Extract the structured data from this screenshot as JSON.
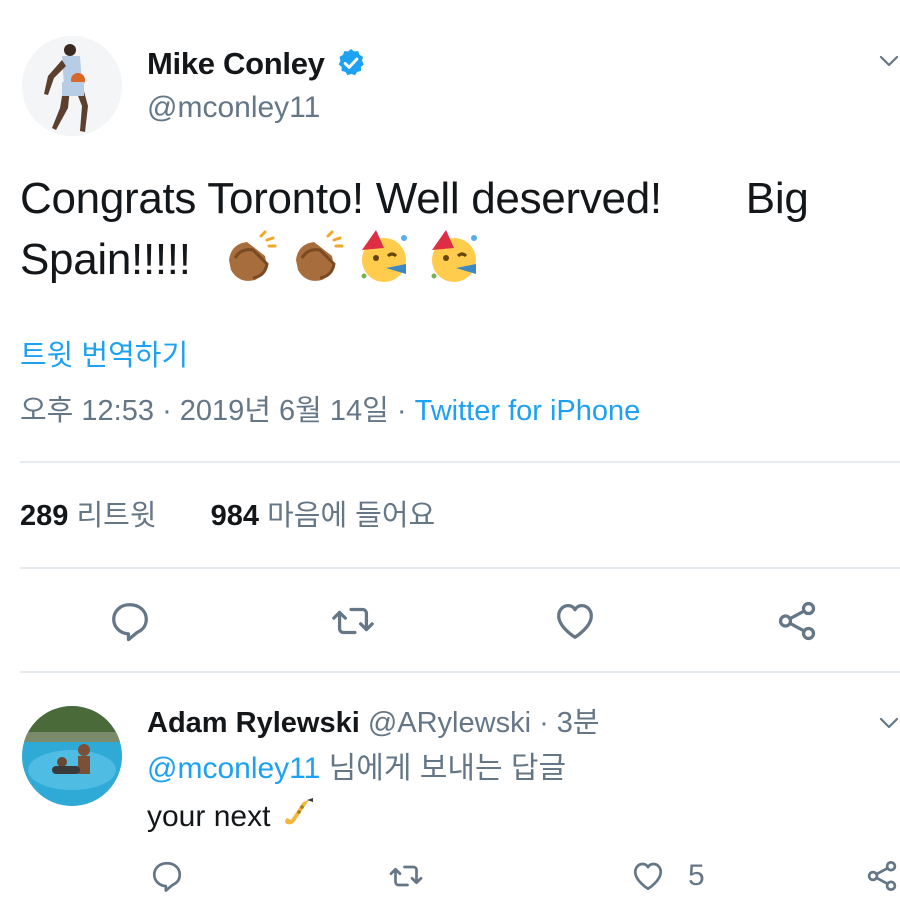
{
  "tweet": {
    "author_name": "Mike Conley",
    "author_handle": "@mconley11",
    "text_line1": "Congrats Toronto! Well deserved!",
    "text_big": "Big",
    "text_line2": "Spain!!!!!",
    "translate_label": "트윗 번역하기",
    "time": "오후 12:53",
    "date": "2019년 6월 14일",
    "source": "Twitter for iPhone",
    "retweet_count": "289",
    "retweet_label": "리트윗",
    "like_count": "984",
    "like_label": "마음에 들어요"
  },
  "reply": {
    "author_name": "Adam Rylewski",
    "author_handle": "@ARylewski",
    "time_ago": "3분",
    "mention": "@mconley11",
    "reply_to_suffix": "님에게 보내는 답글",
    "text": "your next",
    "like_count": "5"
  },
  "colors": {
    "accent": "#1da1f2",
    "secondary_text": "#657786",
    "divider": "#e6ecf0",
    "icon": "#657786"
  }
}
